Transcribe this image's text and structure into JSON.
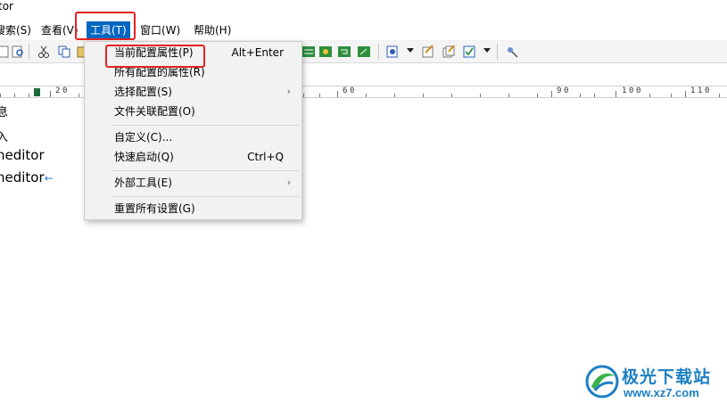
{
  "window": {
    "title": "tor"
  },
  "menubar": {
    "items": [
      {
        "label": "搜索(S)"
      },
      {
        "label": "查看(V)"
      },
      {
        "label": "工具(T)"
      },
      {
        "label": "窗口(W)"
      },
      {
        "label": "帮助(H)"
      }
    ],
    "active_index": 2
  },
  "ruler": {
    "labels": [
      "2",
      "0",
      "6",
      "0",
      "9",
      "0",
      "1",
      "0",
      "0",
      "1",
      "1",
      "0"
    ]
  },
  "editor": {
    "lines": [
      {
        "text": "息"
      },
      {
        "text": "入"
      },
      {
        "text": "neditor"
      },
      {
        "text": "neditor"
      }
    ],
    "return_mark": "←"
  },
  "tools_menu": {
    "items": [
      {
        "label": "当前配置属性(P)",
        "shortcut": "Alt+Enter"
      },
      {
        "label": "所有配置的属性(R)",
        "shortcut": ""
      },
      {
        "label": "选择配置(S)",
        "shortcut": ""
      },
      {
        "label": "文件关联配置(O)",
        "shortcut": ""
      },
      {
        "label": "自定义(C)...",
        "shortcut": ""
      },
      {
        "label": "快速启动(Q)",
        "shortcut": "Ctrl+Q"
      },
      {
        "label": "外部工具(E)",
        "shortcut": ""
      },
      {
        "label": "重置所有设置(G)",
        "shortcut": ""
      }
    ],
    "submenu_arrow": "›"
  },
  "watermark": {
    "brand": "极光下载站",
    "url": "www.xz7.com"
  },
  "colors": {
    "menu_active": "#0067c0",
    "highlight": "#e3231f",
    "watermark": "#1d7fc4"
  }
}
